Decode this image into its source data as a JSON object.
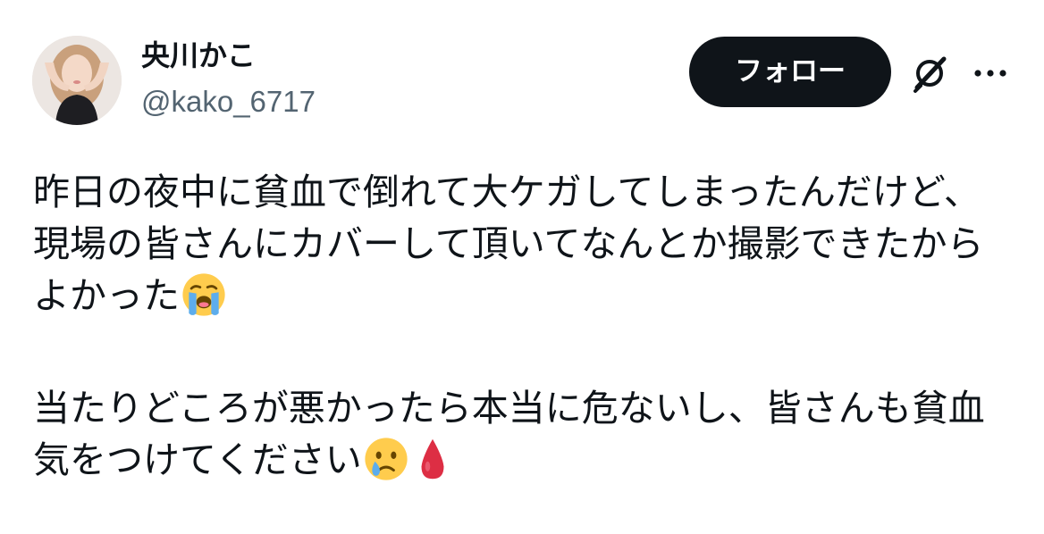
{
  "author": {
    "display_name": "央川かこ",
    "handle": "@kako_6717"
  },
  "actions": {
    "follow_label": "フォロー",
    "grok_icon": "grok-icon",
    "more_icon": "more-options-icon"
  },
  "tweet": {
    "paragraph1": "昨日の夜中に貧血で倒れて大ケガしてしまったんだけど、現場の皆さんにカバーして頂いてなんとか撮影できたからよかった",
    "paragraph1_emoji": "loudly-crying-face-emoji",
    "paragraph2": "当たりどころが悪かったら本当に危ないし、皆さんも貧血気をつけてください",
    "paragraph2_emojis": [
      "crying-face-emoji",
      "drop-of-blood-emoji"
    ]
  },
  "colors": {
    "text_primary": "#0f1419",
    "text_secondary": "#536471",
    "button_bg": "#0f1419",
    "button_text": "#ffffff",
    "emoji_yellow": "#ffcc4d",
    "tear_blue": "#5dadec",
    "blood_red": "#dd2e44"
  }
}
